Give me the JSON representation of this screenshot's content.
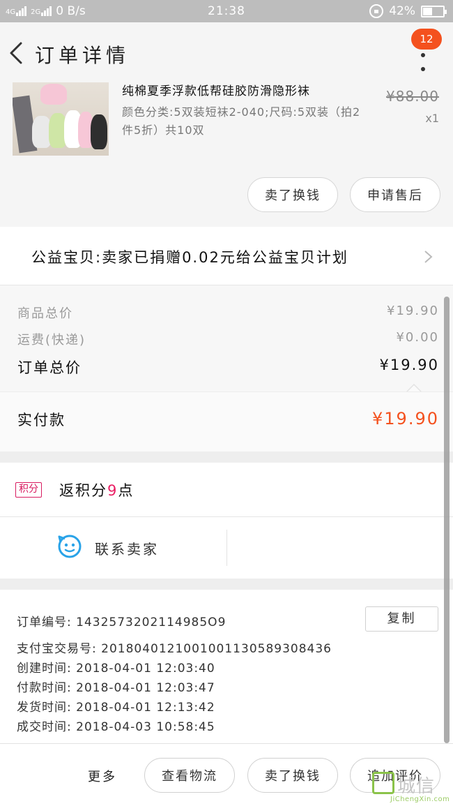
{
  "status_bar": {
    "network_1": "4G",
    "network_2": "2G",
    "speed": "0 B/s",
    "time": "21:38",
    "battery_text": "42%",
    "battery_level": 0.42
  },
  "header": {
    "title": "订单详情",
    "badge_count": "12"
  },
  "product": {
    "name": "纯棉夏季浮款低帮硅胶防滑隐形袜",
    "price": "¥88.00",
    "spec": "颜色分类:5双装短袜2-040;尺码:5双装（拍2件5折）共10双",
    "qty": "x1",
    "buttons": {
      "refund": "卖了换钱",
      "after_sale": "申请售后"
    }
  },
  "charity": {
    "text": "公益宝贝:卖家已捐赠0.02元给公益宝贝计划"
  },
  "summary": {
    "goods_label": "商品总价",
    "goods_value": "¥19.90",
    "shipping_label": "运费(快递)",
    "shipping_value": "¥0.00",
    "total_label": "订单总价",
    "total_value": "¥19.90",
    "paid_label": "实付款",
    "paid_value": "¥19.90"
  },
  "points": {
    "tag": "积分",
    "prefix": "返积分",
    "count": "9",
    "suffix": "点"
  },
  "contact": {
    "label": "联系卖家"
  },
  "order_info": {
    "order_no": "订单编号:  1432573202114985O9",
    "alipay_no": "支付宝交易号:  2018040121001001130589308436",
    "created": "创建时间:  2018-04-01 12:03:40",
    "paid": "付款时间:  2018-04-01 12:03:47",
    "shipped": "发货时间:  2018-04-01 12:13:42",
    "completed": "成交时间:  2018-04-03 10:58:45",
    "copy_label": "复制"
  },
  "bottom_bar": {
    "more": "更多",
    "logistics": "查看物流",
    "refund": "卖了换钱",
    "review": "追加评价"
  },
  "watermark": {
    "big": "城信",
    "small": "JiChengXin.com"
  },
  "colors": {
    "accent": "#f4511e",
    "points": "#e91e63",
    "contact_icon": "#29a3e8",
    "status_bar": "#bdbdbd"
  }
}
